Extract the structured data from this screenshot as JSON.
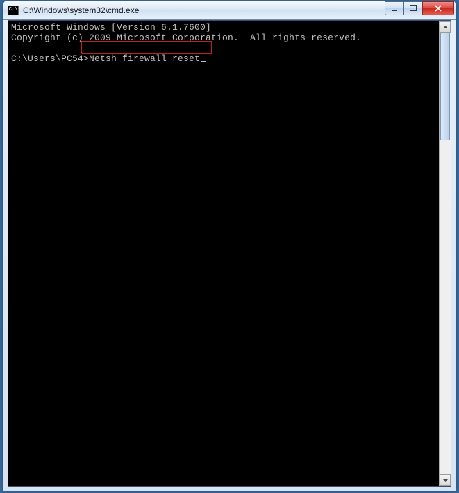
{
  "window": {
    "title": "C:\\Windows\\system32\\cmd.exe",
    "icon": "cmd-icon"
  },
  "controls": {
    "minimize": "minimize",
    "maximize": "maximize",
    "close": "close"
  },
  "console": {
    "line1": "Microsoft Windows [Version 6.1.7600]",
    "line2": "Copyright (c) 2009 Microsoft Corporation.  All rights reserved.",
    "blank": "",
    "prompt": "C:\\Users\\PC54>",
    "command": "Netsh firewall reset"
  },
  "highlight": {
    "label": "command-highlight-box"
  },
  "scrollbar": {
    "up": "scroll-up",
    "down": "scroll-down"
  }
}
